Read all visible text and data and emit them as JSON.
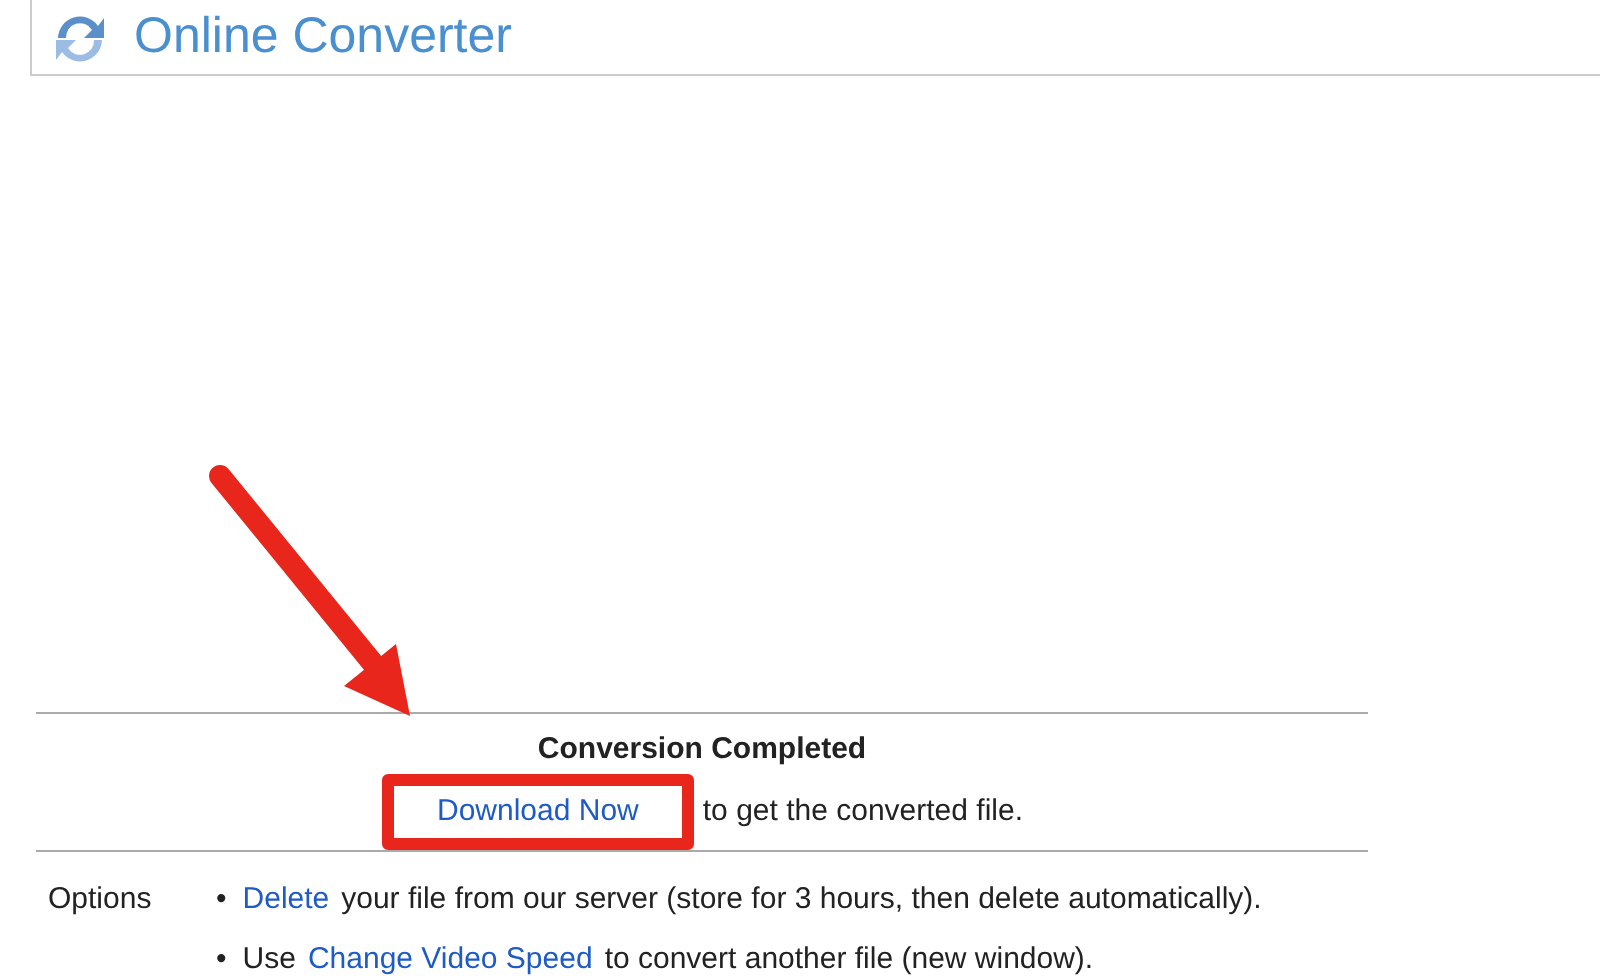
{
  "header": {
    "title": "Online Converter"
  },
  "result": {
    "heading": "Conversion Completed",
    "link": "Download Now",
    "link_highlighted": true,
    "after": "to get the converted file."
  },
  "annotations": [
    {
      "kind": "arrow"
    }
  ],
  "options": {
    "label": "Options",
    "items": [
      {
        "bullet": "•",
        "link": "Delete",
        "after": "your file from our server (store for 3 hours, then delete automatically)."
      },
      {
        "bullet": "•",
        "before": "Use",
        "link": "Change Video Speed",
        "after": "to convert another file (new window)."
      }
    ]
  }
}
